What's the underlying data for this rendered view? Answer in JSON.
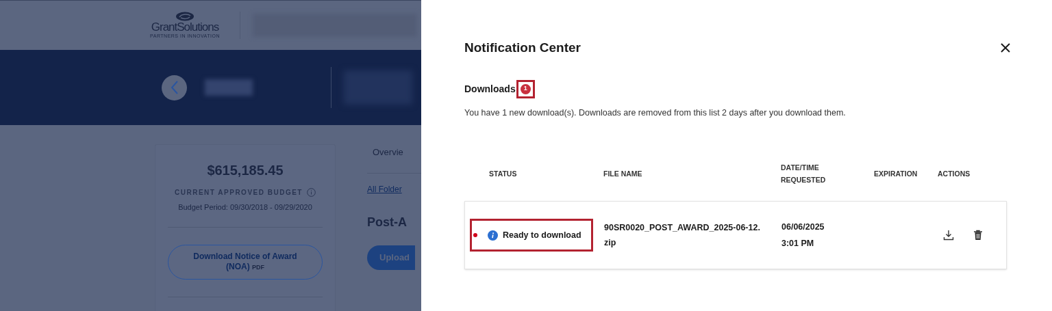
{
  "background_page": {
    "logo": {
      "name": "GrantSolutions",
      "tagline": "PARTNERS IN INNOVATION"
    },
    "budget_card": {
      "amount": "$615,185.45",
      "label": "CURRENT APPROVED BUDGET",
      "period": "Budget Period: 09/30/2018 - 09/29/2020",
      "button_label": "Download Notice of Award",
      "button_suffix": "(NOA)",
      "button_format": "PDF"
    },
    "tab": "Overvie",
    "folders_link": "All Folder",
    "heading": "Post-A",
    "upload_button": "Upload"
  },
  "panel": {
    "title": "Notification Center",
    "section": {
      "title": "Downloads",
      "badge": "1",
      "badge_highlighted": true
    },
    "info": "You have 1 new download(s). Downloads are removed from this list 2 days after you download them.",
    "table": {
      "columns": [
        "STATUS",
        "FILE NAME",
        "DATE/TIME REQUESTED",
        "EXPIRATION",
        "ACTIONS"
      ],
      "rows": [
        {
          "unread": true,
          "status": "Ready to download",
          "status_highlighted": true,
          "file_name": "90SR0020_POST_AWARD_2025-06-12.zip",
          "date": "06/06/2025",
          "time": "3:01 PM"
        }
      ]
    }
  }
}
